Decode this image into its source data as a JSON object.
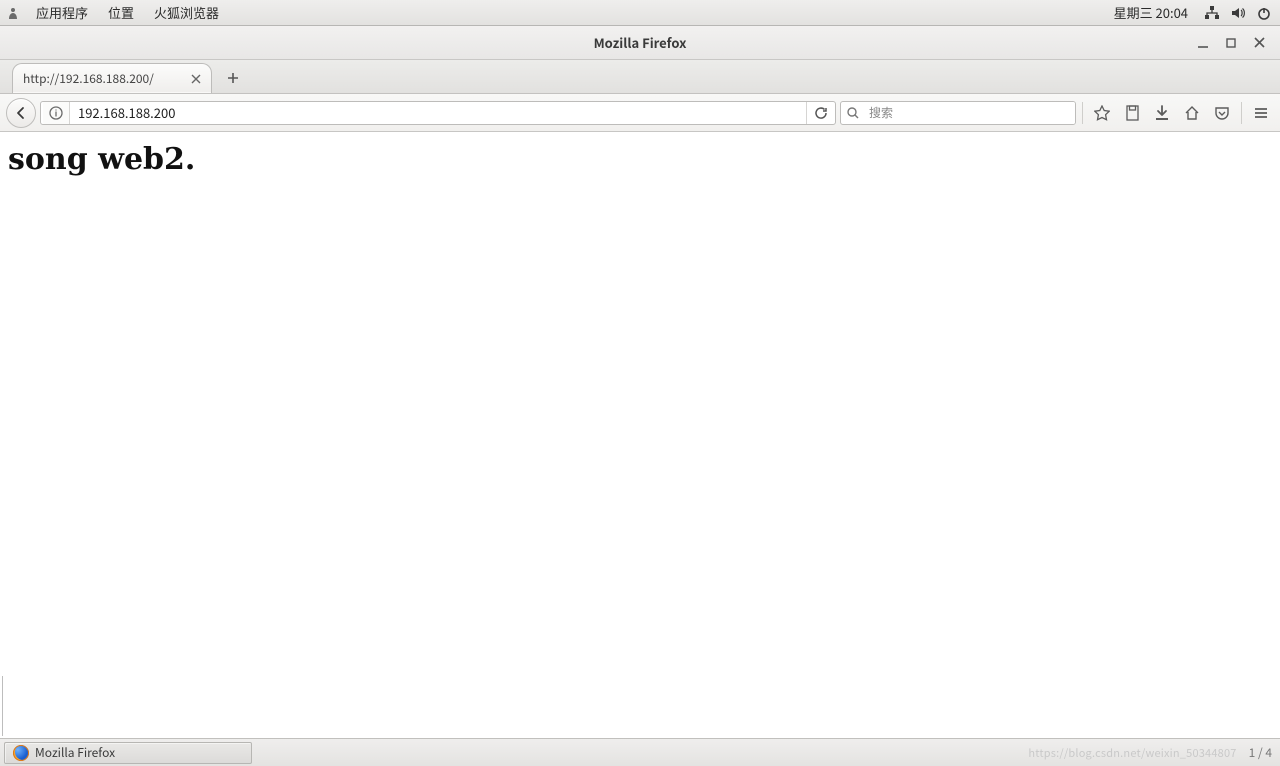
{
  "panel": {
    "menus": {
      "applications": "应用程序",
      "places": "位置",
      "firefox": "火狐浏览器"
    },
    "clock": "星期三 20:04"
  },
  "window": {
    "title": "Mozilla Firefox"
  },
  "tab": {
    "title": "http://192.168.188.200/"
  },
  "urlbar": {
    "value": "192.168.188.200"
  },
  "searchbar": {
    "placeholder": "搜索"
  },
  "page": {
    "heading": "song web2."
  },
  "taskbar": {
    "app": "Mozilla Firefox",
    "watermark": "https://blog.csdn.net/weixin_50344807",
    "pager": "1 / 4"
  }
}
